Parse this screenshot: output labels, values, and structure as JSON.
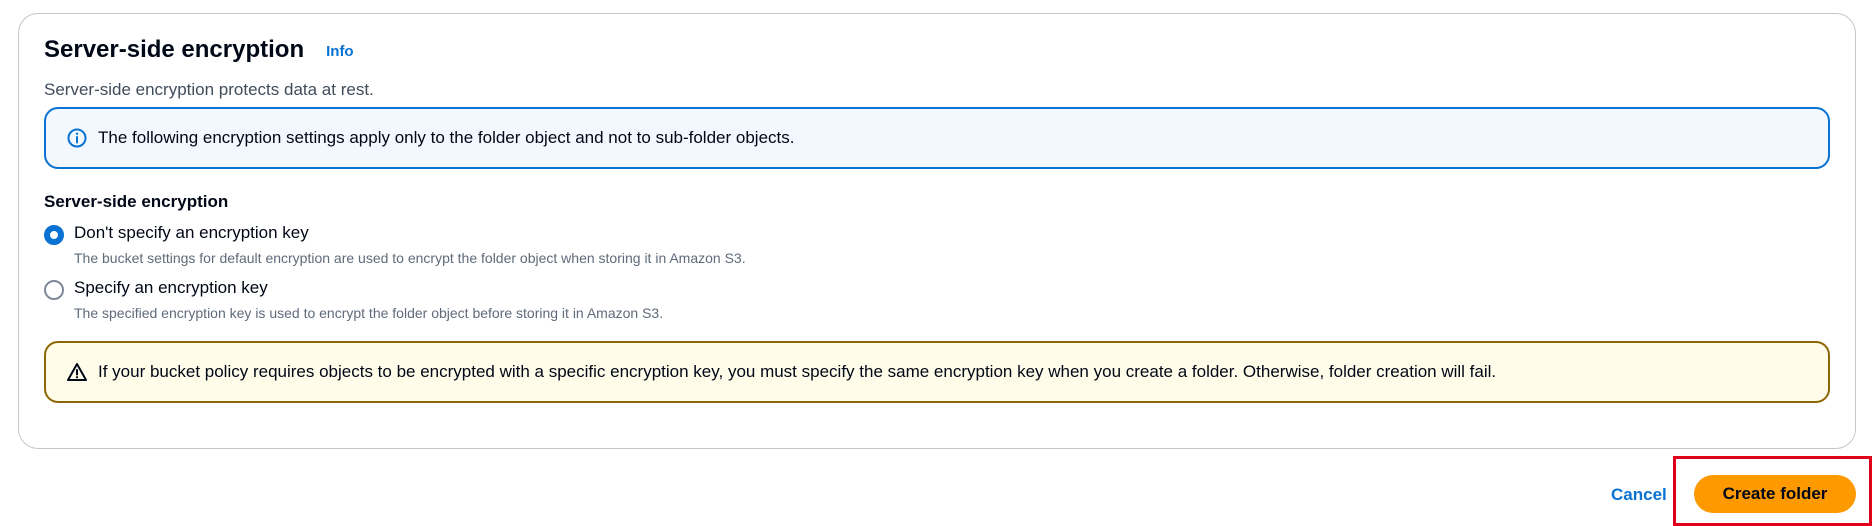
{
  "section": {
    "title": "Server-side encryption",
    "info_label": "Info",
    "description": "Server-side encryption protects data at rest."
  },
  "info_alert": {
    "icon": "info-circle-icon",
    "text": "The following encryption settings apply only to the folder object and not to sub-folder objects."
  },
  "encryption_field": {
    "label": "Server-side encryption",
    "options": [
      {
        "label": "Don't specify an encryption key",
        "description": "The bucket settings for default encryption are used to encrypt the folder object when storing it in Amazon S3.",
        "selected": true
      },
      {
        "label": "Specify an encryption key",
        "description": "The specified encryption key is used to encrypt the folder object before storing it in Amazon S3.",
        "selected": false
      }
    ]
  },
  "warning_alert": {
    "icon": "warning-triangle-icon",
    "text": "If your bucket policy requires objects to be encrypted with a specific encryption key, you must specify the same encryption key when you create a folder. Otherwise, folder creation will fail."
  },
  "actions": {
    "cancel_label": "Cancel",
    "create_label": "Create folder"
  },
  "colors": {
    "link": "#0972d3",
    "primary_button": "#ff9900",
    "info_border": "#0972d3",
    "warning_border": "#8d6605",
    "highlight": "#e0001b"
  }
}
